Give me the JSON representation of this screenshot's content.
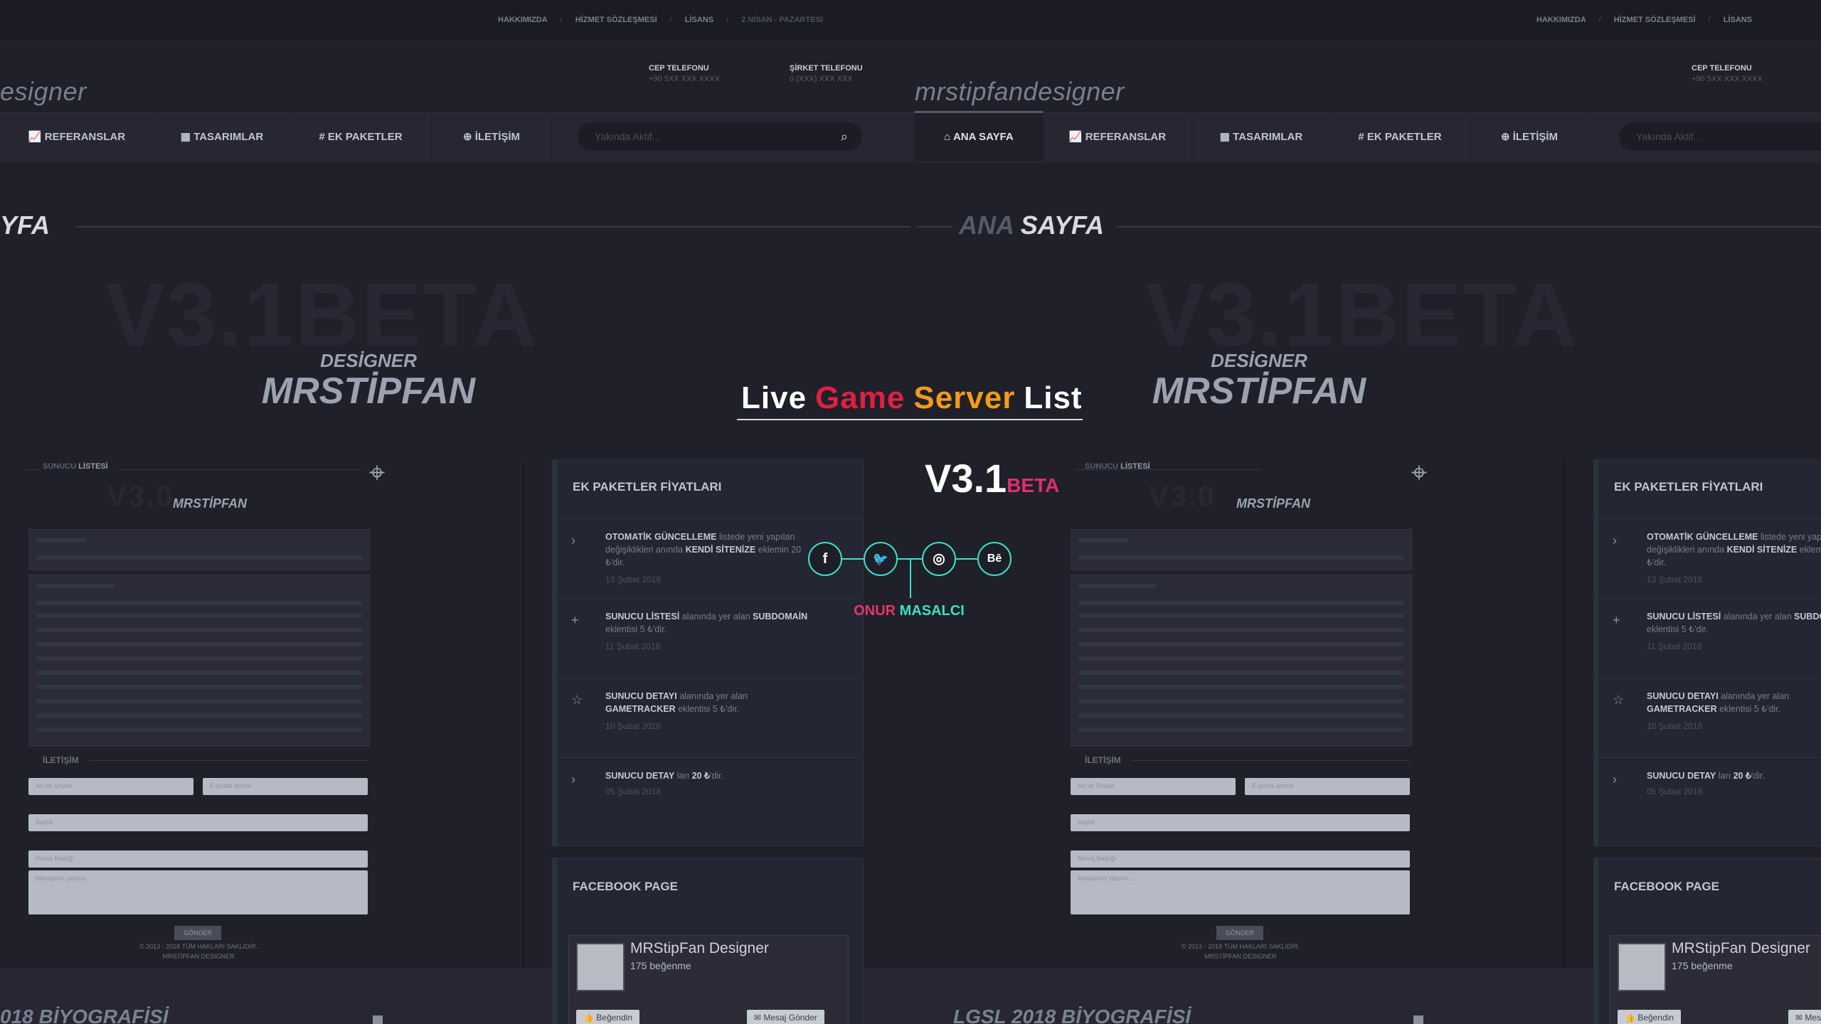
{
  "topbar": {
    "about": "HAKKIMIZDA",
    "contract": "HİZMET SÖZLEŞMESİ",
    "license": "LİSANS",
    "date": "2 NİSAN - PAZARTESİ",
    "separator": "/"
  },
  "header": {
    "brand": "mrstipfandesigner",
    "brand_left": "esigner",
    "mobile_label": "CEP TELEFONU",
    "mobile_value": "+90 5XX XXX XXXX",
    "company_label": "ŞİRKET TELEFONU",
    "company_value": "0 (XXX) XXX XXX"
  },
  "nav": {
    "home": "ANA SAYFA",
    "references": "REFERANSLAR",
    "designs": "TASARIMLAR",
    "packages": "EK PAKETLER",
    "contact": "İLETİŞİM",
    "search_placeholder": "Yakında Aktif..."
  },
  "hero": {
    "section_dim": "ANA",
    "section_main": "SAYFA",
    "section_cropped": "YFA",
    "watermark": "V3.1BETA",
    "designer_small": "DESİGNER",
    "designer_big": "MRSTİPFAN",
    "server_list_dim": "SUNUCU",
    "server_list_main": "LİSTESİ",
    "mini_watermark": "V3.0",
    "contact_label": "İLETİŞİM",
    "name_placeholder": "Ad ve Soyad",
    "email_placeholder": "E-posta adresi",
    "subject_placeholder": "Başlık",
    "message_title_placeholder": "Mesaj Başlığı",
    "message_placeholder": "Mesajınızı yazınız...",
    "send_button": "GÖNDER",
    "footer_line1": "© 2013 - 2018 TÜM HAKLARI SAKLIDIR.",
    "footer_line2": "MRSTİPFAN DESIGNER",
    "bottom_title": "LGSL 2018 BİYOGRAFİSİ",
    "bottom_title_left": "018 BİYOGRAFİSİ"
  },
  "packages_card": {
    "title": "EK PAKETLER FİYATLARI",
    "items": [
      {
        "icon": "›",
        "bold": "OTOMATİK GÜNCELLEME",
        "text": " listede yeni yapılan değişiklikleri anında ",
        "bold2": "KENDİ SİTENİZE",
        "text2": " eklemin 20 ₺'dir.",
        "date": "13 Şubat 2018"
      },
      {
        "icon": "+",
        "bold": "SUNUCU LİSTESİ",
        "text": " alanında yer alan ",
        "bold2": "SUBDOMAİN",
        "text2": " eklentisi 5 ₺'dir.",
        "date": "11 Şubat 2018"
      },
      {
        "icon": "☆",
        "bold": "SUNUCU DETAYI",
        "text": " alanında yer alan ",
        "bold2": "GAMETRACKER",
        "text2": " eklentisi 5 ₺'dir.",
        "date": "10 Şubat 2018"
      },
      {
        "icon": "›",
        "bold": "SUNUCU DETAY",
        "text": " ları ",
        "bold2": "20 ₺",
        "text2": "'dir.",
        "date": "05 Şubat 2018"
      }
    ]
  },
  "facebook_card": {
    "title": "FACEBOOK PAGE",
    "page_name": "MRStipFan Designer",
    "likes": "175 beğenme",
    "like_button": "Beğendin",
    "message_button": "Mesaj Gönder"
  },
  "overlay": {
    "headline_1": "Live",
    "headline_2": "Game",
    "headline_3": "Server",
    "headline_4": "List",
    "version": "V3.1",
    "beta": "BETA",
    "social": [
      "f",
      "🐦",
      "◎",
      "Bē"
    ],
    "author_first": "ONUR",
    "author_last": "MASALCI"
  },
  "colors": {
    "accent_teal": "#3ee0c4",
    "accent_pink": "#e83566",
    "game_red": "#e02040",
    "server_orange": "#f39a1c"
  }
}
